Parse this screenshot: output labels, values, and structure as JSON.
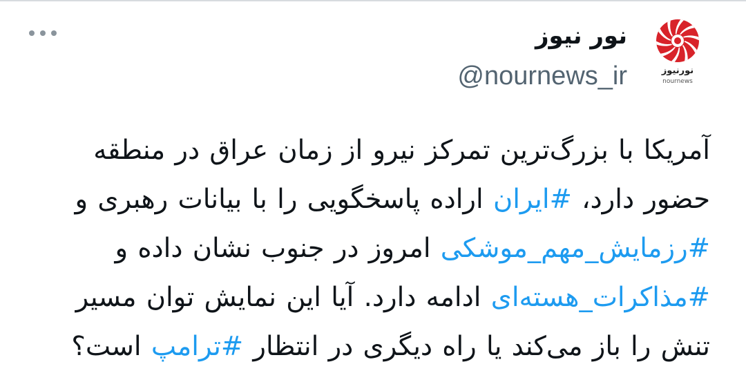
{
  "account": {
    "display_name": "نور نیوز",
    "handle": "@nournews_ir",
    "logo_text": "نورنیوز",
    "logo_subtext": "nournews"
  },
  "tweet": {
    "lines": [
      [
        {
          "t": "آمریکا با بزرگ‌ترین تمرکز نیرو از زمان عراق در منطقه",
          "h": false
        }
      ],
      [
        {
          "t": "حضور دارد، ",
          "h": false
        },
        {
          "t": "#ایران",
          "h": true
        },
        {
          "t": " اراده پاسخگویی را با بیانات رهبری و",
          "h": false
        }
      ],
      [
        {
          "t": "#رزمایش_مهم_موشکی",
          "h": true
        },
        {
          "t": " امروز در جنوب نشان داده و",
          "h": false
        }
      ],
      [
        {
          "t": "#مذاکرات_هسته‌ای",
          "h": true
        },
        {
          "t": " ادامه دارد. آیا این نمایش توان مسیر",
          "h": false
        }
      ],
      [
        {
          "t": "تنش را باز می‌کند یا راه دیگری در انتظار ",
          "h": false
        },
        {
          "t": "#ترامپ",
          "h": true
        },
        {
          "t": " است؟",
          "h": false
        }
      ]
    ]
  },
  "colors": {
    "hashtag": "#1d9bf0",
    "handle": "#536471",
    "logo_red": "#d8232a"
  },
  "icons": {
    "more": "more-horizontal-icon"
  }
}
